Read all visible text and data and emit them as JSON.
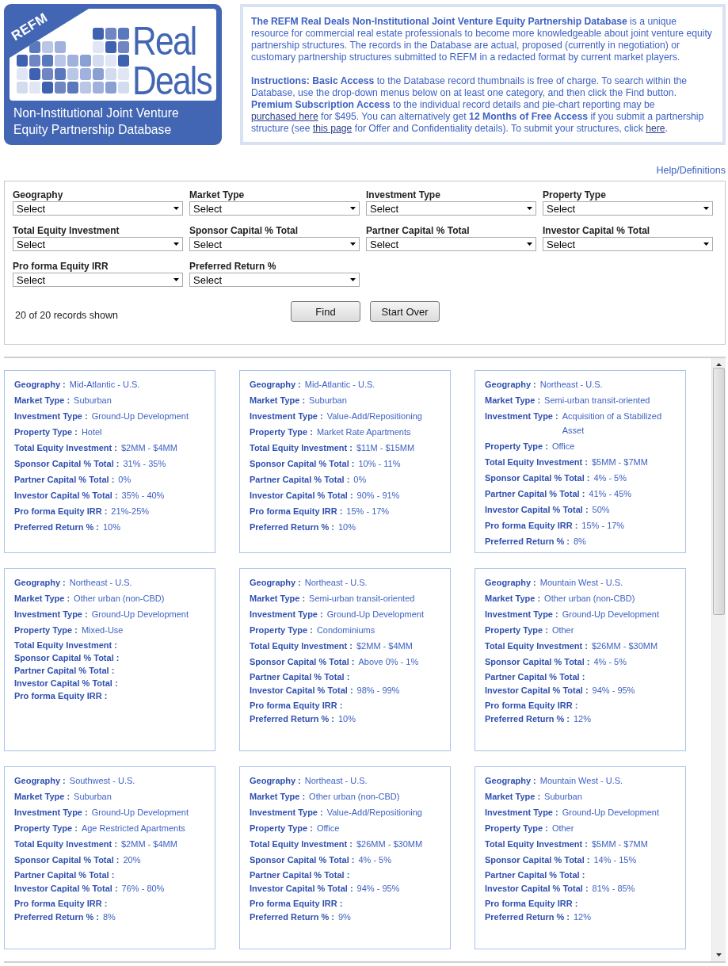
{
  "logo": {
    "badge": "REFM",
    "title_lines": [
      "Real",
      "Deals"
    ],
    "subtitle_lines": [
      "Non-Institutional Joint Venture",
      "Equity Partnership Database"
    ]
  },
  "intro": {
    "paragraphs": [
      [
        {
          "kind": "text",
          "text": "**The REFM Real Deals Non-Institutional Joint Venture Equity Partnership Database** is a unique resource for commercial real estate professionals to become more knowledgeable about joint venture equity partnership structures. The records in the Database are actual, proposed (currently in negotiation) or customary partnership structures submitted to REFM in a redacted format by current market players."
        }
      ],
      [
        {
          "kind": "text",
          "text": "**Instructions: Basic Access** to the Database record thumbnails is free of charge. To search within the Database, use the drop-down menus below on at least one category, and then click the Find button. **Premium Subscription Access** to the individual record details and pie-chart reporting may be "
        },
        {
          "kind": "link",
          "text": "purchased here"
        },
        {
          "kind": "text",
          "text": " for $495. You can alternatively get **12 Months of Free Access** if you submit a partnership structure (see "
        },
        {
          "kind": "link",
          "text": "this page"
        },
        {
          "kind": "text",
          "text": " for Offer and Confidentiality details). To submit your structures, click "
        },
        {
          "kind": "link",
          "text": "here"
        },
        {
          "kind": "text",
          "text": "."
        }
      ]
    ]
  },
  "help_link": "Help/Definitions",
  "filters": [
    {
      "label": "Geography",
      "value": "Select"
    },
    {
      "label": "Market Type",
      "value": "Select"
    },
    {
      "label": "Investment Type",
      "value": "Select"
    },
    {
      "label": "Property Type",
      "value": "Select"
    },
    {
      "label": "Total Equity Investment",
      "value": "Select"
    },
    {
      "label": "Sponsor Capital % Total",
      "value": "Select"
    },
    {
      "label": "Partner Capital % Total",
      "value": "Select"
    },
    {
      "label": "Investor Capital % Total",
      "value": "Select"
    },
    {
      "label": "Pro forma Equity IRR",
      "value": "Select"
    },
    {
      "label": "Preferred Return %",
      "value": "Select"
    }
  ],
  "records_shown": "20 of 20 records shown",
  "buttons": [
    "Find",
    "Start Over"
  ],
  "records": [
    {
      "fields": [
        {
          "label": "Geography :",
          "value": "Mid-Atlantic - U.S."
        },
        {
          "label": "Market Type :",
          "value": "Suburban"
        },
        {
          "label": "Investment Type :",
          "value": "Ground-Up Development"
        },
        {
          "label": "Property Type :",
          "value": "Hotel"
        },
        {
          "label": "Total Equity Investment :",
          "value": "$2MM - $4MM"
        },
        {
          "label": "Sponsor Capital % Total :",
          "value": "31% - 35%"
        },
        {
          "label": "Partner Capital % Total :",
          "value": "0%"
        },
        {
          "label": "Investor Capital % Total :",
          "value": "35% - 40%"
        },
        {
          "label": "Pro forma Equity IRR :",
          "value": "21%-25%"
        },
        {
          "label": "Preferred Return % :",
          "value": "10%"
        }
      ]
    },
    {
      "fields": [
        {
          "label": "Geography :",
          "value": "Mid-Atlantic - U.S."
        },
        {
          "label": "Market Type :",
          "value": "Suburban"
        },
        {
          "label": "Investment Type :",
          "value": "Value-Add/Repositioning"
        },
        {
          "label": "Property Type :",
          "value": "Market Rate Apartments"
        },
        {
          "label": "Total Equity Investment :",
          "value": "$11M - $15MM"
        },
        {
          "label": "Sponsor Capital % Total :",
          "value": "10% - 11%"
        },
        {
          "label": "Partner Capital % Total :",
          "value": "0%"
        },
        {
          "label": "Investor Capital % Total :",
          "value": "90% - 91%"
        },
        {
          "label": "Pro forma Equity IRR :",
          "value": "15% - 17%"
        },
        {
          "label": "Preferred Return % :",
          "value": "10%"
        }
      ]
    },
    {
      "fields": [
        {
          "label": "Geography :",
          "value": "Northeast - U.S."
        },
        {
          "label": "Market Type :",
          "value": "Semi-urban transit-oriented"
        },
        {
          "label": "Investment Type :",
          "value": "Acquisition of a Stabilized Asset"
        },
        {
          "label": "Property Type :",
          "value": "Office"
        },
        {
          "label": "Total Equity Investment :",
          "value": "$5MM - $7MM"
        },
        {
          "label": "Sponsor Capital % Total :",
          "value": "4% - 5%"
        },
        {
          "label": "Partner Capital % Total :",
          "value": "41% - 45%"
        },
        {
          "label": "Investor Capital % Total :",
          "value": "50%"
        },
        {
          "label": "Pro forma Equity IRR :",
          "value": "15% - 17%"
        },
        {
          "label": "Preferred Return % :",
          "value": "8%"
        }
      ]
    },
    {
      "fields": [
        {
          "label": "Geography :",
          "value": "Northeast - U.S."
        },
        {
          "label": "Market Type :",
          "value": "Other urban (non-CBD)"
        },
        {
          "label": "Investment Type :",
          "value": "Ground-Up Development"
        },
        {
          "label": "Property Type :",
          "value": "Mixed-Use"
        },
        {
          "label": "Total Equity Investment :"
        },
        {
          "label": "Sponsor Capital % Total :"
        },
        {
          "label": "Partner Capital % Total :"
        },
        {
          "label": "Investor Capital % Total :"
        },
        {
          "label": "Pro forma Equity IRR :"
        }
      ]
    },
    {
      "fields": [
        {
          "label": "Geography :",
          "value": "Northeast - U.S."
        },
        {
          "label": "Market Type :",
          "value": "Semi-urban transit-oriented"
        },
        {
          "label": "Investment Type :",
          "value": "Ground-Up Development"
        },
        {
          "label": "Property Type :",
          "value": "Condominiums"
        },
        {
          "label": "Total Equity Investment :",
          "value": "$2MM - $4MM"
        },
        {
          "label": "Sponsor Capital % Total :",
          "value": "Above 0% - 1%"
        },
        {
          "label": "Partner Capital % Total :"
        },
        {
          "label": "Investor Capital % Total :",
          "value": "98% - 99%"
        },
        {
          "label": "Pro forma Equity IRR :"
        },
        {
          "label": "Preferred Return % :",
          "value": "10%"
        }
      ]
    },
    {
      "fields": [
        {
          "label": "Geography :",
          "value": "Mountain West - U.S."
        },
        {
          "label": "Market Type :",
          "value": "Other urban (non-CBD)"
        },
        {
          "label": "Investment Type :",
          "value": "Ground-Up Development"
        },
        {
          "label": "Property Type :",
          "value": "Other"
        },
        {
          "label": "Total Equity Investment :",
          "value": "$26MM - $30MM"
        },
        {
          "label": "Sponsor Capital % Total :",
          "value": "4% - 5%"
        },
        {
          "label": "Partner Capital % Total :"
        },
        {
          "label": "Investor Capital % Total :",
          "value": "94% - 95%"
        },
        {
          "label": "Pro forma Equity IRR :"
        },
        {
          "label": "Preferred Return % :",
          "value": "12%"
        }
      ]
    },
    {
      "fields": [
        {
          "label": "Geography :",
          "value": "Southwest - U.S."
        },
        {
          "label": "Market Type :",
          "value": "Suburban"
        },
        {
          "label": "Investment Type :",
          "value": "Ground-Up Development"
        },
        {
          "label": "Property Type :",
          "value": "Age Restricted Apartments"
        },
        {
          "label": "Total Equity Investment :",
          "value": "$2MM - $4MM"
        },
        {
          "label": "Sponsor Capital % Total :",
          "value": "20%"
        },
        {
          "label": "Partner Capital % Total :"
        },
        {
          "label": "Investor Capital % Total :",
          "value": "76% - 80%"
        },
        {
          "label": "Pro forma Equity IRR :"
        },
        {
          "label": "Preferred Return % :",
          "value": "8%"
        }
      ]
    },
    {
      "fields": [
        {
          "label": "Geography :",
          "value": "Northeast - U.S."
        },
        {
          "label": "Market Type :",
          "value": "Other urban (non-CBD)"
        },
        {
          "label": "Investment Type :",
          "value": "Value-Add/Repositioning"
        },
        {
          "label": "Property Type :",
          "value": "Office"
        },
        {
          "label": "Total Equity Investment :",
          "value": "$26MM - $30MM"
        },
        {
          "label": "Sponsor Capital % Total :",
          "value": "4% - 5%"
        },
        {
          "label": "Partner Capital % Total :"
        },
        {
          "label": "Investor Capital % Total :",
          "value": "94% - 95%"
        },
        {
          "label": "Pro forma Equity IRR :"
        },
        {
          "label": "Preferred Return % :",
          "value": "9%"
        }
      ]
    },
    {
      "fields": [
        {
          "label": "Geography :",
          "value": "Mountain West - U.S."
        },
        {
          "label": "Market Type :",
          "value": "Suburban"
        },
        {
          "label": "Investment Type :",
          "value": "Ground-Up Development"
        },
        {
          "label": "Property Type :",
          "value": "Other"
        },
        {
          "label": "Total Equity Investment :",
          "value": "$5MM - $7MM"
        },
        {
          "label": "Sponsor Capital % Total :",
          "value": "14% - 15%"
        },
        {
          "label": "Partner Capital % Total :"
        },
        {
          "label": "Investor Capital % Total :",
          "value": "81% - 85%"
        },
        {
          "label": "Pro forma Equity IRR :"
        },
        {
          "label": "Preferred Return % :",
          "value": "12%"
        }
      ]
    }
  ]
}
